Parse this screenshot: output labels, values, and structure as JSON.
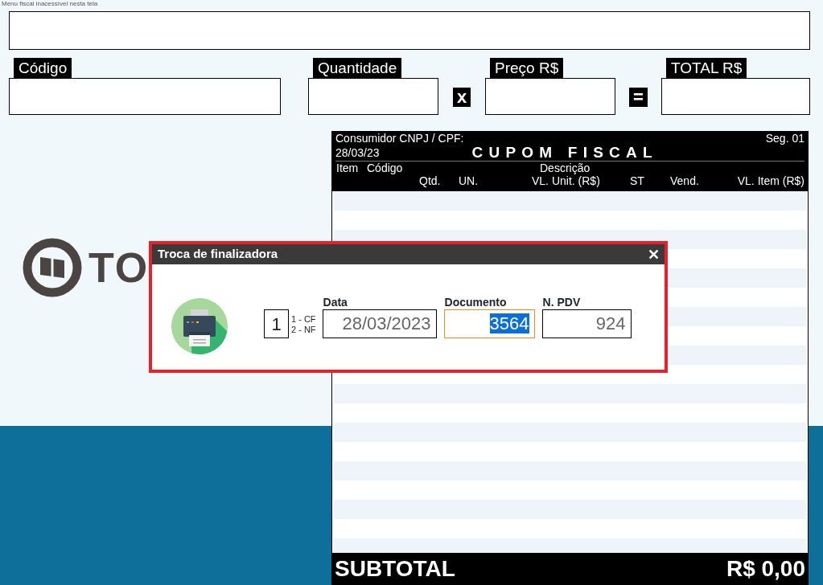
{
  "notice": "Menu fiscal inacessível nesta tela",
  "entry_fields": [
    {
      "kind": "field",
      "label": "Código"
    },
    {
      "kind": "field",
      "label": "Quantidade"
    },
    {
      "kind": "operator",
      "label": "x"
    },
    {
      "kind": "field",
      "label": "Preço R$"
    },
    {
      "kind": "operator",
      "label": "="
    },
    {
      "kind": "field",
      "label": "TOTAL R$"
    }
  ],
  "logo_text": "TO",
  "receipt": {
    "consumer_label": "Consumidor CNPJ / CPF:",
    "segment": "Seg. 01",
    "date": "28/03/23",
    "title": "CUPOM FISCAL",
    "columns_top": [
      "Item",
      "Código",
      "Descrição"
    ],
    "columns_bottom": [
      "Qtd.",
      "UN.",
      "VL. Unit. (R$)",
      "ST",
      "Vend.",
      "VL. Item (R$)"
    ],
    "subtotal_label": "SUBTOTAL",
    "subtotal_value": "R$ 0,00"
  },
  "dialog": {
    "title": "Troca de finalizadora",
    "close": "✕",
    "type_value": "1",
    "type_options": [
      "1 - CF",
      "2 - NF"
    ],
    "fields": [
      {
        "label": "Data",
        "value": "28/03/2023",
        "focused": false
      },
      {
        "label": "Documento",
        "value": "3564",
        "focused": true
      },
      {
        "label": "N. PDV",
        "value": "924",
        "focused": false
      }
    ]
  }
}
